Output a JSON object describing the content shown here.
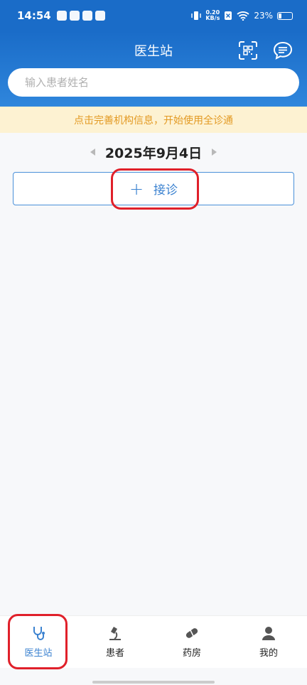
{
  "status_bar": {
    "time": "14:54",
    "net_speed_top": "0.20",
    "net_speed_bottom": "KB/s",
    "battery": "23%"
  },
  "header": {
    "title": "医生站",
    "search_placeholder": "输入患者姓名"
  },
  "notice": {
    "text": "点击完善机构信息，开始使用全诊通"
  },
  "date_nav": {
    "date": "2025年9月4日"
  },
  "reception": {
    "plus": "+",
    "label": "接诊"
  },
  "tabs": [
    {
      "label": "医生站",
      "icon": "stethoscope-icon",
      "active": true
    },
    {
      "label": "患者",
      "icon": "microscope-icon",
      "active": false
    },
    {
      "label": "药房",
      "icon": "pill-icon",
      "active": false
    },
    {
      "label": "我的",
      "icon": "user-icon",
      "active": false
    }
  ],
  "colors": {
    "primary": "#1a6cc8",
    "accent": "#3b82d0",
    "notice_bg": "#fdf2d2",
    "notice_text": "#e39a23",
    "highlight": "#e0202a"
  }
}
